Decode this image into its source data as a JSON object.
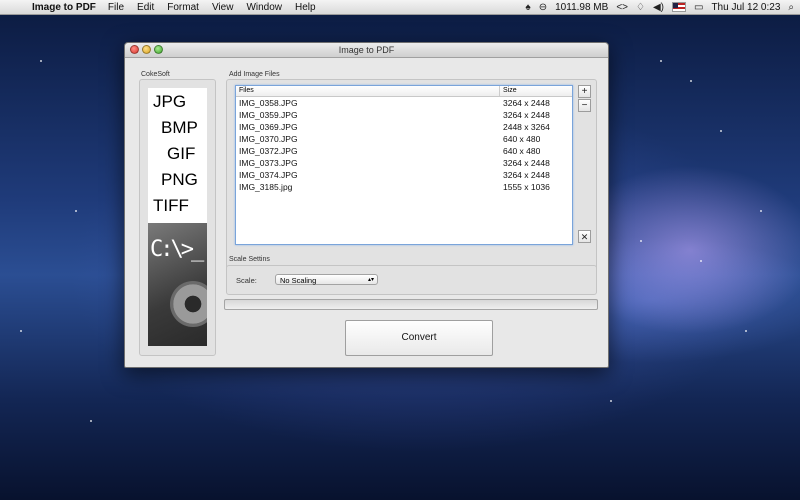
{
  "menubar": {
    "apple": "",
    "app_name": "Image to PDF",
    "items": [
      "File",
      "Edit",
      "Format",
      "View",
      "Window",
      "Help"
    ],
    "memory": "1011.98 MB",
    "clock": "Thu Jul 12  0:23"
  },
  "window": {
    "title": "Image to PDF",
    "sidebar_label": "CokeSoft",
    "formats": [
      "JPG",
      "BMP",
      "GIF",
      "PNG",
      "TIFF"
    ],
    "cmd_prompt": "C:\\>_",
    "files_label": "Add Image Files",
    "columns": {
      "files": "Files",
      "size": "Size"
    },
    "files": [
      {
        "name": "IMG_0358.JPG",
        "size": "3264 x 2448"
      },
      {
        "name": "IMG_0359.JPG",
        "size": "3264 x 2448"
      },
      {
        "name": "IMG_0369.JPG",
        "size": "2448 x 3264"
      },
      {
        "name": "IMG_0370.JPG",
        "size": "640 x 480"
      },
      {
        "name": "IMG_0372.JPG",
        "size": "640 x 480"
      },
      {
        "name": "IMG_0373.JPG",
        "size": "3264 x 2448"
      },
      {
        "name": "IMG_0374.JPG",
        "size": "3264 x 2448"
      },
      {
        "name": "IMG_3185.jpg",
        "size": "1555 x 1036"
      }
    ],
    "add_label": "+",
    "remove_label": "−",
    "clear_label": "✕",
    "scale_section_label": "Scale Settins",
    "scale_label": "Scale:",
    "scale_value": "No Scaling",
    "progress": 0,
    "convert_label": "Convert"
  }
}
